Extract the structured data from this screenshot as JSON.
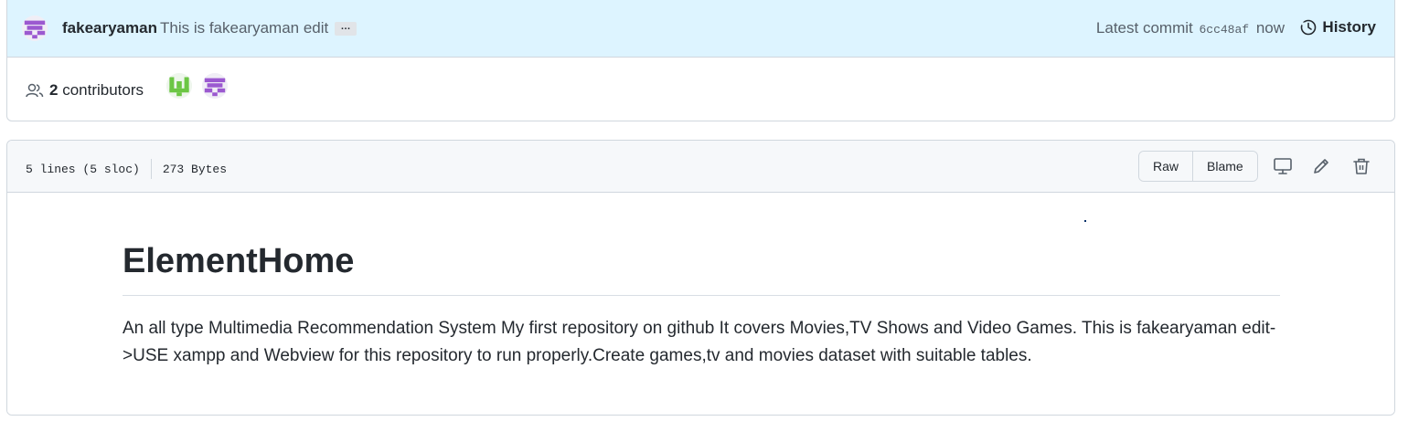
{
  "commit": {
    "author": "fakearyaman",
    "message": "This is fakearyaman edit",
    "ellipsis": "…",
    "latest_label": "Latest commit",
    "sha": "6cc48af",
    "time": "now",
    "history_label": "History"
  },
  "contributors": {
    "count": "2",
    "label": "contributors",
    "avatars": [
      "green-identicon",
      "purple-identicon"
    ]
  },
  "file": {
    "lines": "5 lines (5 sloc)",
    "size": "273 Bytes",
    "raw_label": "Raw",
    "blame_label": "Blame",
    "icons": [
      "display-icon",
      "pencil-icon",
      "trash-icon"
    ]
  },
  "readme": {
    "title": "ElementHome",
    "body": "An all type Multimedia Recommendation System My first repository on github It covers Movies,TV Shows and Video Games. This is fakearyaman edit->USE xampp and Webview for this repository to run properly.Create games,tv and movies dataset with suitable tables."
  },
  "colors": {
    "commit_bg": "#ddf4ff",
    "border": "#d0d7de",
    "identicon_purple": "#9b59d0",
    "identicon_green": "#6cc644"
  }
}
